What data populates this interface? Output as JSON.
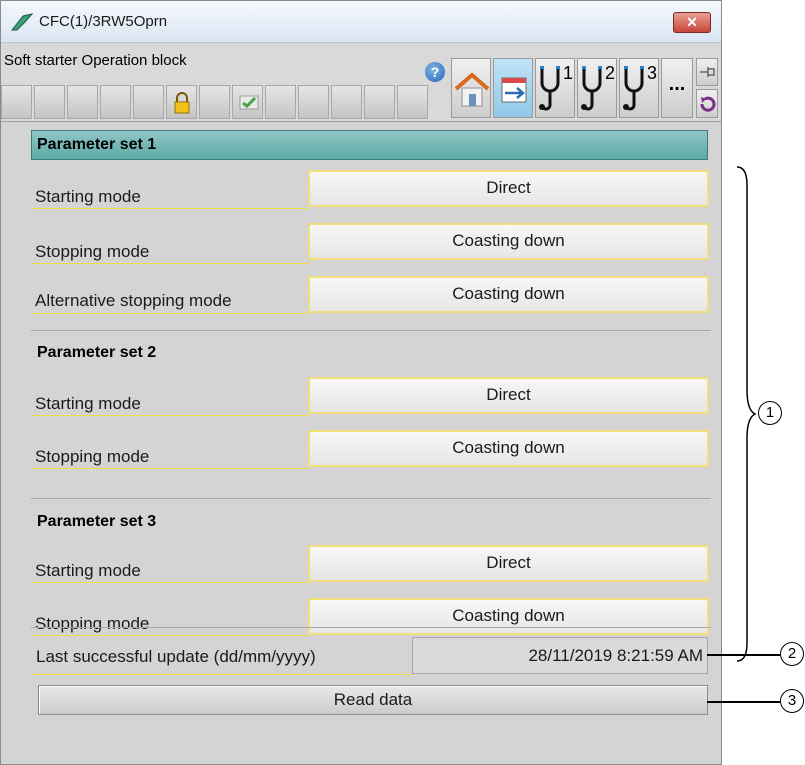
{
  "window": {
    "title": "CFC(1)/3RW5Oprn",
    "close_symbol": "✕"
  },
  "header": {
    "block_name": "Soft starter Operation block",
    "help_symbol": "?",
    "probe_labels": [
      "1",
      "2",
      "3"
    ],
    "more_label": "..."
  },
  "parameter_sets": [
    {
      "title": "Parameter set 1",
      "rows": [
        {
          "label": "Starting mode",
          "value": "Direct"
        },
        {
          "label": "Stopping mode",
          "value": "Coasting down"
        },
        {
          "label": "Alternative stopping mode",
          "value": "Coasting down"
        }
      ]
    },
    {
      "title": "Parameter set 2",
      "rows": [
        {
          "label": "Starting mode",
          "value": "Direct"
        },
        {
          "label": "Stopping mode",
          "value": "Coasting down"
        }
      ]
    },
    {
      "title": "Parameter set 3",
      "rows": [
        {
          "label": "Starting mode",
          "value": "Direct"
        },
        {
          "label": "Stopping mode",
          "value": "Coasting down"
        }
      ]
    }
  ],
  "last_update": {
    "label": "Last successful update (dd/mm/yyyy)",
    "value": "28/11/2019  8:21:59 AM"
  },
  "read_button": {
    "label": "Read data"
  },
  "callouts": [
    "1",
    "2",
    "3"
  ],
  "colors": {
    "section_highlight": "#70b5b2",
    "field_border": "#f1e07a",
    "close_button": "#c7443a"
  }
}
